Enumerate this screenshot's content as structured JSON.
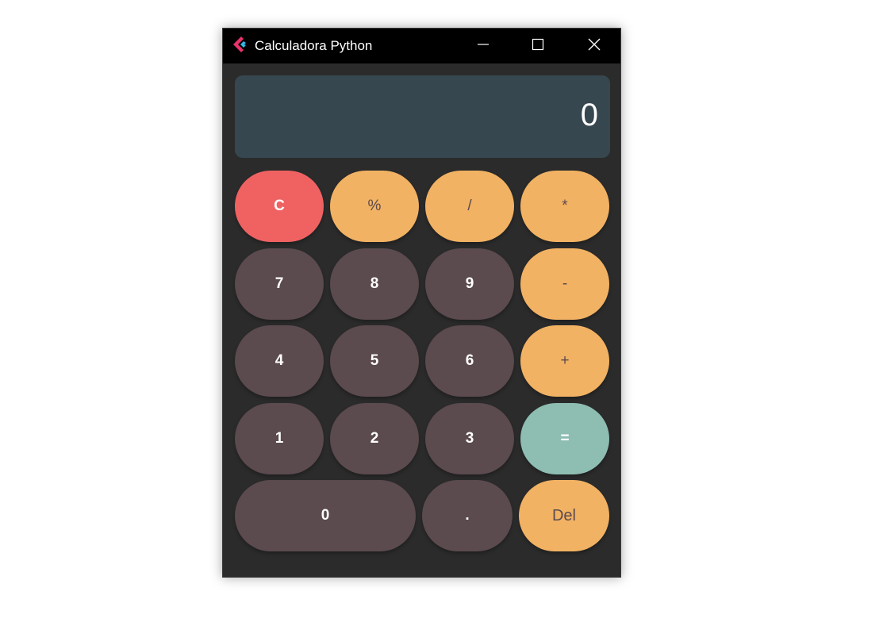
{
  "window": {
    "title": "Calculadora Python"
  },
  "display": {
    "value": "0"
  },
  "keys": {
    "clear": "C",
    "percent": "%",
    "divide": "/",
    "multiply": "*",
    "seven": "7",
    "eight": "8",
    "nine": "9",
    "minus": "-",
    "four": "4",
    "five": "5",
    "six": "6",
    "plus": "+",
    "one": "1",
    "two": "2",
    "three": "3",
    "equals": "=",
    "zero": "0",
    "dot": ".",
    "delete": "Del"
  },
  "colors": {
    "clear": "#f06262",
    "operator": "#f2b263",
    "number": "#5b4a4e",
    "equals": "#8ebdb2",
    "display": "#37474f",
    "background": "#2b2b2b",
    "titlebar": "#000000"
  },
  "icons": {
    "app": "flutter-logo-icon",
    "minimize": "minimize-icon",
    "maximize": "maximize-icon",
    "close": "close-icon"
  }
}
